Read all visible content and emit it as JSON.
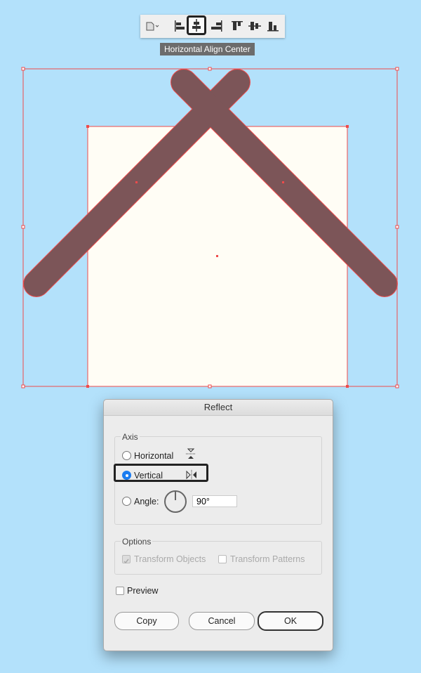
{
  "toolbar": {
    "items": [
      "shape-dropdown-icon",
      "horizontal-align-left-icon",
      "horizontal-align-center-icon",
      "horizontal-align-right-icon",
      "vertical-align-top-icon",
      "vertical-align-center-icon",
      "vertical-align-bottom-icon"
    ],
    "active": "horizontal-align-center-icon"
  },
  "tooltip": "Horizontal Align Center",
  "colors": {
    "background": "#b3e1fb",
    "square": "#fffdf5",
    "bars": "#7c5558",
    "selection": "#ef4b4b"
  },
  "dialog": {
    "title": "Reflect",
    "axis_label": "Axis",
    "horizontal": "Horizontal",
    "vertical": "Vertical",
    "angle": "Angle:",
    "angle_value": "90°",
    "selected": "Vertical",
    "options_label": "Options",
    "transform_objects": "Transform Objects",
    "transform_patterns": "Transform Patterns",
    "preview": "Preview",
    "copy": "Copy",
    "cancel": "Cancel",
    "ok": "OK"
  }
}
